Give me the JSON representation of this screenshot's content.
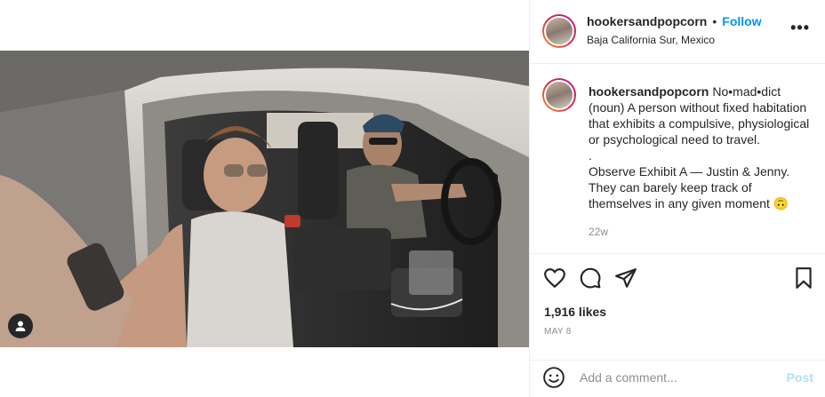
{
  "post": {
    "username": "hookersandpopcorn",
    "separator": "•",
    "follow_label": "Follow",
    "location": "Baja California Sur, Mexico",
    "more_label": "•••"
  },
  "caption": {
    "username": "hookersandpopcorn",
    "lines": [
      "No•mad•dict (noun) A person without fixed habitation that exhibits a compulsive, physiological or psychological need to travel.",
      ".",
      "Observe Exhibit A — Justin & Jenny. They can barely keep track of themselves in any given moment 🙃"
    ],
    "age": "22w"
  },
  "actions": {
    "like_icon": "heart-icon",
    "comment_icon": "comment-icon",
    "share_icon": "paper-plane-icon",
    "save_icon": "bookmark-icon"
  },
  "stats": {
    "likes": "1,916 likes",
    "date": "MAY 8"
  },
  "comment_box": {
    "placeholder": "Add a comment...",
    "post_label": "Post"
  },
  "colors": {
    "accent": "#0095f6",
    "post_disabled": "#b2dffc",
    "muted": "#8e8e8e",
    "border": "#efefef"
  }
}
